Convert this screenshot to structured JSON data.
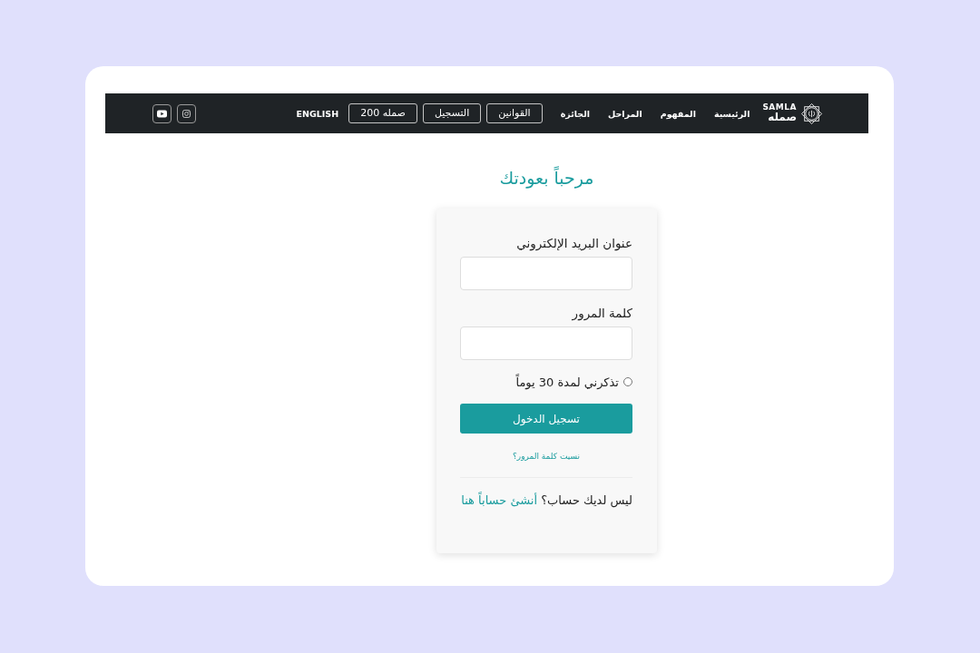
{
  "nav": {
    "logo": {
      "latin": "SAMLA",
      "arabic": "صمله"
    },
    "items": [
      {
        "label": "الرئيسية",
        "kind": "link"
      },
      {
        "label": "المفهوم",
        "kind": "link"
      },
      {
        "label": "المراحل",
        "kind": "link"
      },
      {
        "label": "الجائزة",
        "kind": "link"
      },
      {
        "label": "القوانين",
        "kind": "outlined"
      },
      {
        "label": "التسجيل",
        "kind": "outlined"
      },
      {
        "label": "صمله 200",
        "kind": "outlined"
      },
      {
        "label": "ENGLISH",
        "kind": "link"
      }
    ],
    "social": [
      {
        "kind": "play"
      },
      {
        "kind": "camera"
      }
    ]
  },
  "login": {
    "title": "مرحباً بعودتك",
    "fields": [
      {
        "label": "عنوان البريد الإلكتروني"
      },
      {
        "label": "كلمة المرور"
      }
    ],
    "remember": {
      "label": "تذكرني لمدة 30 يوماً",
      "checked": false
    },
    "submit": "تسجيل الدخول",
    "forgot": "نسيت كلمة المرور؟",
    "signup": {
      "text": "ليس لديك حساب؟",
      "link": "أنشئ حساباً هنا"
    }
  }
}
